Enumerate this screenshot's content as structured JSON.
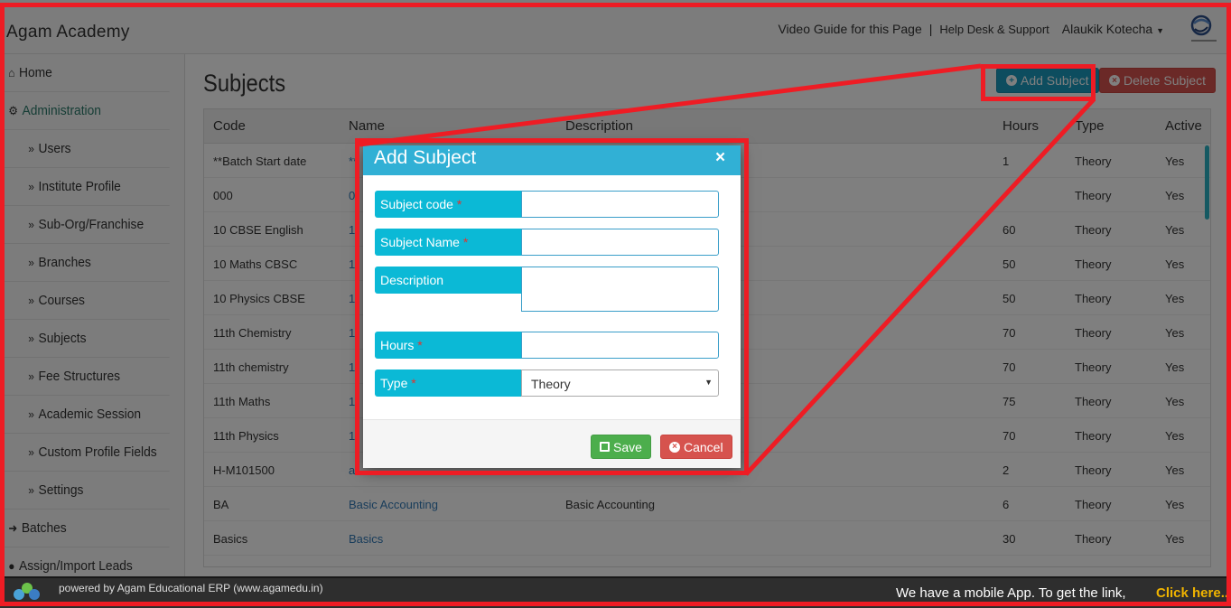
{
  "header": {
    "brand": "Agam Academy",
    "video_guide": "Video Guide for this Page",
    "separator": "|",
    "help_desk": "Help Desk & Support",
    "user": "Alaukik Kotecha"
  },
  "sidebar": {
    "items": [
      {
        "label": "Home",
        "icon": "home-icon"
      },
      {
        "label": "Administration",
        "icon": "gear-icon"
      },
      {
        "label": "Users",
        "icon": "double-chevron-icon"
      },
      {
        "label": "Institute Profile",
        "icon": "double-chevron-icon"
      },
      {
        "label": "Sub-Org/Franchise",
        "icon": "double-chevron-icon"
      },
      {
        "label": "Branches",
        "icon": "double-chevron-icon"
      },
      {
        "label": "Courses",
        "icon": "double-chevron-icon"
      },
      {
        "label": "Subjects",
        "icon": "double-chevron-icon"
      },
      {
        "label": "Fee Structures",
        "icon": "double-chevron-icon"
      },
      {
        "label": "Academic Session",
        "icon": "double-chevron-icon"
      },
      {
        "label": "Custom Profile Fields",
        "icon": "double-chevron-icon"
      },
      {
        "label": "Settings",
        "icon": "double-chevron-icon"
      },
      {
        "label": "Batches",
        "icon": "sign-in-icon"
      },
      {
        "label": "Assign/Import Leads",
        "icon": "user-icon"
      }
    ]
  },
  "main": {
    "title": "Subjects",
    "add_button": "Add Subject",
    "delete_button": "Delete Subject"
  },
  "table": {
    "columns": [
      "Code",
      "Name",
      "Description",
      "Hours",
      "Type",
      "Active"
    ],
    "rows": [
      {
        "code": "**Batch Start date",
        "name": "**",
        "description": "",
        "hours": "1",
        "type": "Theory",
        "active": "Yes"
      },
      {
        "code": "000",
        "name": "0",
        "description": "",
        "hours": "",
        "type": "Theory",
        "active": "Yes"
      },
      {
        "code": "10 CBSE English",
        "name": "1",
        "description": "",
        "hours": "60",
        "type": "Theory",
        "active": "Yes"
      },
      {
        "code": "10 Maths CBSC",
        "name": "1",
        "description": "",
        "hours": "50",
        "type": "Theory",
        "active": "Yes"
      },
      {
        "code": "10 Physics CBSE",
        "name": "1",
        "description": "",
        "hours": "50",
        "type": "Theory",
        "active": "Yes"
      },
      {
        "code": "11th Chemistry",
        "name": "1",
        "description": "",
        "hours": "70",
        "type": "Theory",
        "active": "Yes"
      },
      {
        "code": "11th chemistry",
        "name": "1",
        "description": "",
        "hours": "70",
        "type": "Theory",
        "active": "Yes"
      },
      {
        "code": "11th Maths",
        "name": "1",
        "description": "",
        "hours": "75",
        "type": "Theory",
        "active": "Yes"
      },
      {
        "code": "11th Physics",
        "name": "1",
        "description": "",
        "hours": "70",
        "type": "Theory",
        "active": "Yes"
      },
      {
        "code": "H-M101500",
        "name": "a",
        "description": "",
        "hours": "2",
        "type": "Theory",
        "active": "Yes"
      },
      {
        "code": "BA",
        "name": "Basic Accounting",
        "description": "Basic Accounting",
        "hours": "6",
        "type": "Theory",
        "active": "Yes"
      },
      {
        "code": "Basics",
        "name": "Basics",
        "description": "",
        "hours": "30",
        "type": "Theory",
        "active": "Yes"
      }
    ]
  },
  "modal": {
    "title": "Add Subject",
    "close": "×",
    "required_mark": "*",
    "fields": {
      "subject_code": {
        "label": "Subject code",
        "value": ""
      },
      "subject_name": {
        "label": "Subject Name",
        "value": ""
      },
      "description": {
        "label": "Description",
        "value": ""
      },
      "hours": {
        "label": "Hours",
        "value": ""
      },
      "type": {
        "label": "Type",
        "value": "Theory"
      }
    },
    "save": "Save",
    "cancel": "Cancel"
  },
  "footer": {
    "powered_by": "powered by Agam Educational ERP (www.agamedu.in)",
    "mobile_app": "We have a mobile App. To get the link,",
    "click_here": "Click here.."
  },
  "colors": {
    "accent": "#1b9bbf",
    "danger": "#d6534e",
    "success": "#4cae4c",
    "label_bg": "#0bb9d6",
    "highlight": "#ee1c24"
  }
}
